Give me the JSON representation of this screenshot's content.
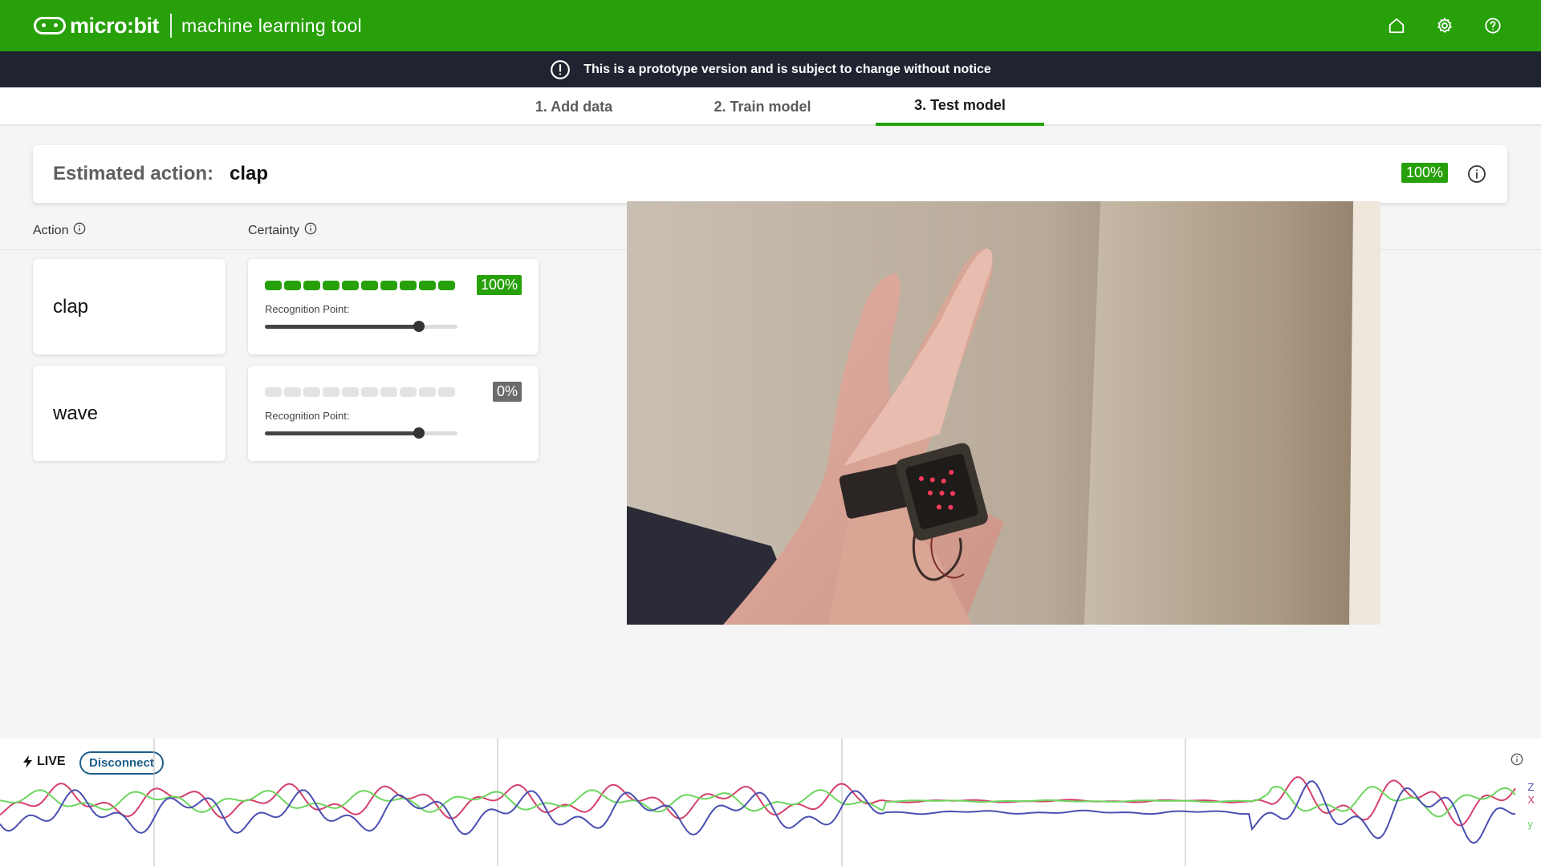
{
  "header": {
    "brand_name": "micro:bit",
    "tool_name": "machine learning tool",
    "icons": [
      "home-icon",
      "settings-icon",
      "help-icon"
    ]
  },
  "banner": {
    "text": "This is a prototype version and is subject to change without notice"
  },
  "tabs": [
    {
      "label": "1. Add data",
      "active": false
    },
    {
      "label": "2. Train model",
      "active": false
    },
    {
      "label": "3. Test model",
      "active": true
    }
  ],
  "estimate": {
    "label": "Estimated action:",
    "value": "clap",
    "certainty": "100%"
  },
  "columns": {
    "action": "Action",
    "certainty": "Certainty"
  },
  "actions": [
    {
      "name": "clap",
      "certainty_label": "100%",
      "certainty": 1.0,
      "recognition_label": "Recognition Point:",
      "recognition_point": 0.8
    },
    {
      "name": "wave",
      "certainty_label": "0%",
      "certainty": 0.0,
      "recognition_label": "Recognition Point:",
      "recognition_point": 0.8
    }
  ],
  "live": {
    "label": "LIVE",
    "disconnect_label": "Disconnect",
    "axes": [
      "z",
      "x",
      "y"
    ]
  },
  "colors": {
    "brand_green": "#27a00a",
    "banner_dark": "#1f2430",
    "axis_x": "#d4416a",
    "axis_y": "#6cd65e",
    "axis_z": "#4a4fb0",
    "inactive_gray": "#6b6b6b"
  }
}
